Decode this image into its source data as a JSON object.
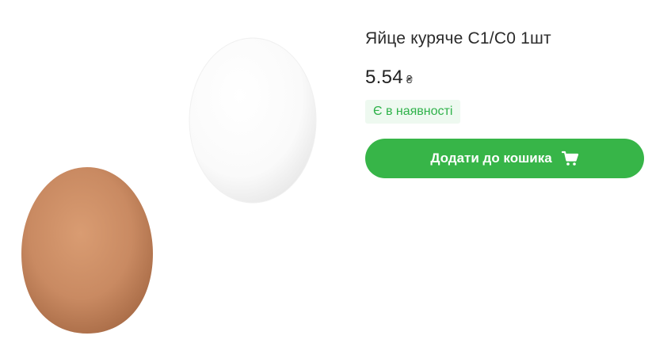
{
  "product": {
    "title": "Яйце куряче С1/С0 1шт",
    "price": "5.54",
    "currency": "₴",
    "availability": "Є в наявності"
  },
  "actions": {
    "add_to_cart_label": "Додати до кошика"
  },
  "icons": {
    "cart": "cart-icon"
  },
  "colors": {
    "accent": "#37b548",
    "availability_text": "#2fb24a",
    "availability_bg": "#eef9f0",
    "brown_egg": "#c98a62",
    "white_egg": "#ffffff"
  }
}
